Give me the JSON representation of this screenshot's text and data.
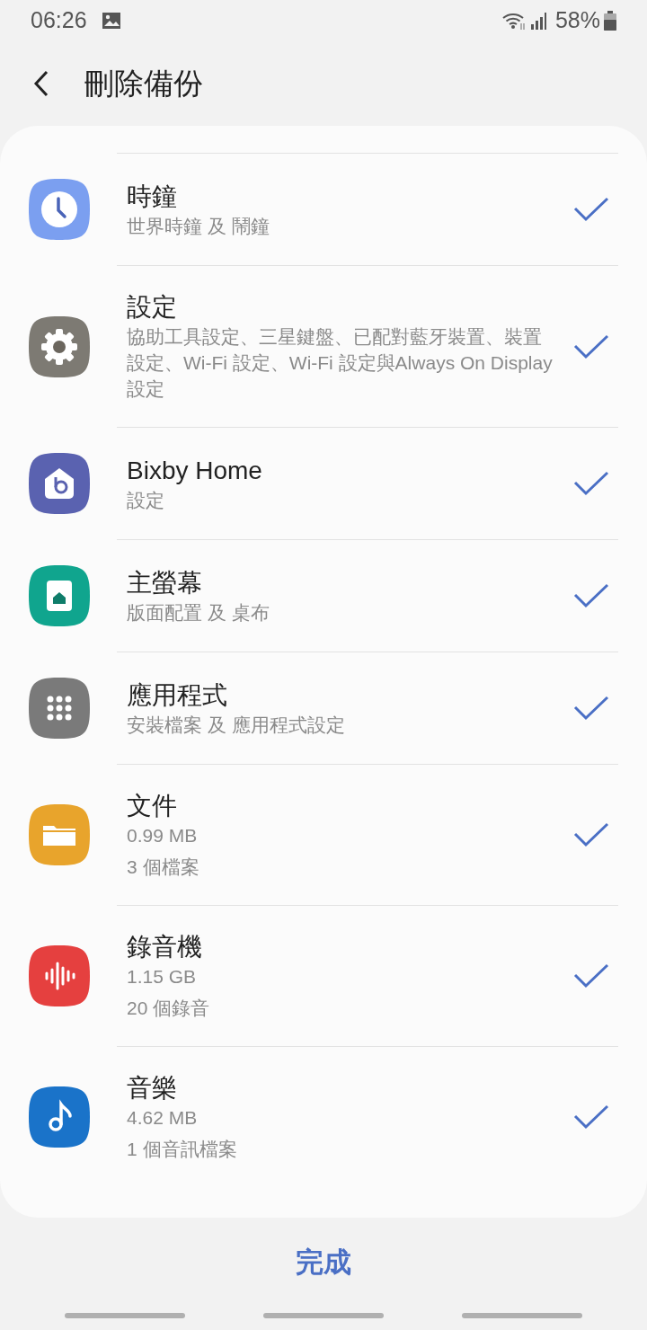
{
  "status_bar": {
    "time": "06:26",
    "battery": "58%"
  },
  "header": {
    "title": "刪除備份"
  },
  "items": [
    {
      "kind": "clock",
      "color": "#7b9ff0",
      "title": "時鐘",
      "subtitles": [
        "世界時鐘 及 鬧鐘"
      ],
      "checked": true
    },
    {
      "kind": "gear",
      "color": "#7d7a73",
      "title": "設定",
      "subtitles": [
        "協助工具設定、三星鍵盤、已配對藍牙裝置、裝置設定、Wi-Fi 設定、Wi-Fi 設定與Always On Display 設定"
      ],
      "checked": true
    },
    {
      "kind": "bixby",
      "color": "#5a62b0",
      "title": "Bixby Home",
      "subtitles": [
        "設定"
      ],
      "checked": true
    },
    {
      "kind": "home",
      "color": "#10a58e",
      "title": "主螢幕",
      "subtitles": [
        "版面配置 及 桌布"
      ],
      "checked": true
    },
    {
      "kind": "apps",
      "color": "#7a7a7a",
      "title": "應用程式",
      "subtitles": [
        "安裝檔案 及 應用程式設定"
      ],
      "checked": true
    },
    {
      "kind": "folder",
      "color": "#e8a42c",
      "title": "文件",
      "subtitles": [
        "0.99 MB",
        "3 個檔案"
      ],
      "checked": true
    },
    {
      "kind": "wave",
      "color": "#e5403f",
      "title": "錄音機",
      "subtitles": [
        "1.15 GB",
        "20 個錄音"
      ],
      "checked": true
    },
    {
      "kind": "note",
      "color": "#1a73c9",
      "title": "音樂",
      "subtitles": [
        "4.62 MB",
        "1 個音訊檔案"
      ],
      "checked": true
    }
  ],
  "done_button": "完成"
}
